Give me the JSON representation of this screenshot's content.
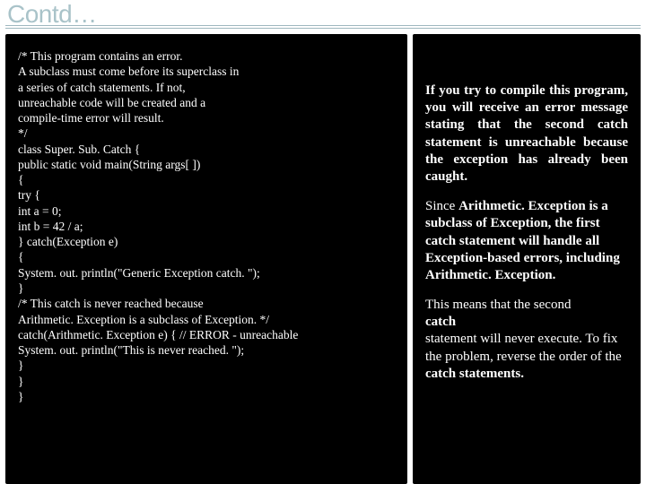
{
  "header": {
    "title": "Contd…"
  },
  "code": {
    "l1": "/* This program contains an error.",
    "l2": "A subclass must come before its superclass in",
    "l3": "a series of catch statements. If not,",
    "l4": "unreachable code will be created and a",
    "l5": "compile-time error will result.",
    "l6": "*/",
    "l7": "class Super. Sub. Catch {",
    "l8": "public static void main(String args[ ])",
    "l9": "{",
    "l10": "try {",
    "l11": "int a = 0;",
    "l12": "int b = 42 / a;",
    "l13": "} catch(Exception e)",
    "l14": "{",
    "l15": "System. out. println(\"Generic Exception catch. \");",
    "l16": "}",
    "l17": "/* This catch is never reached because",
    "l18": "Arithmetic. Exception is a subclass of Exception. */",
    "l19": "catch(Arithmetic. Exception e) { // ERROR - unreachable",
    "l20": "System. out. println(\"This is never reached. \");",
    "l21": "}",
    "l22": "}",
    "l23": "}"
  },
  "note": {
    "p1": "If you try to compile this program, you will receive an error message stating that the second catch statement is unreachable because the exception has already been caught.",
    "p2a": "Since ",
    "p2b": "Arithmetic. Exception ",
    "p2c": "is a subclass of Exception, the first catch statement will handle all",
    "p2d": "Exception-based errors, including",
    "p2e": "Arithmetic. Exception.",
    "p3a": "This means that the second",
    "p3b": "catch",
    "p3c": "statement will never execute. To fix the problem, reverse the order of the ",
    "p3d": "catch statements."
  }
}
